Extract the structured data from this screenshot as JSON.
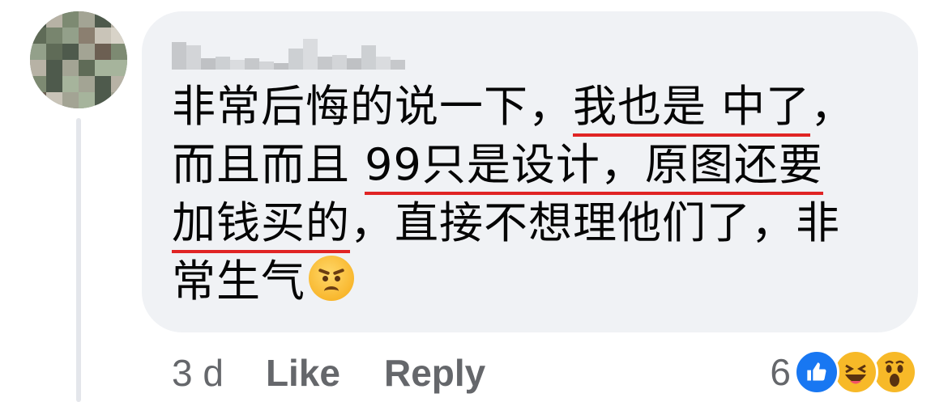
{
  "comment": {
    "author_name_blurred": true,
    "lines": [
      [
        "非常后悔的说一下，",
        "我也是 中了",
        "，"
      ],
      [
        "而且而且 ",
        "99只是设计，原图还要"
      ],
      [
        "加钱买的",
        "，直接不想理他们了，非"
      ],
      [
        "常生气"
      ]
    ],
    "emoji": "angry-face-emoji"
  },
  "meta": {
    "time": "3 d",
    "like_label": "Like",
    "reply_label": "Reply"
  },
  "reactions": {
    "count": "6",
    "types": [
      "like",
      "haha",
      "wow"
    ],
    "colors": {
      "like": "#1877f2",
      "haha": "#f7b928",
      "wow": "#f7b928"
    }
  },
  "colors": {
    "bubble": "#f0f2f5",
    "text": "#050505",
    "meta": "#65676b",
    "underline": "#e02424"
  }
}
